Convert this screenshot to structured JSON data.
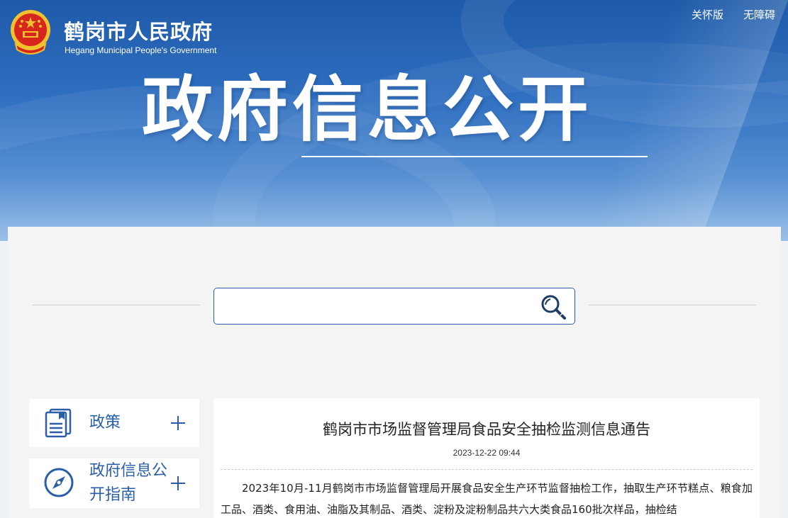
{
  "header": {
    "site_name": "鹤岗市人民政府",
    "site_name_en": "Hegang Municipal People's Government",
    "links": {
      "care": "关怀版",
      "accessibility": "无障碍"
    },
    "hero_title": "政府信息公开"
  },
  "search": {
    "value": "",
    "icon": "search-icon"
  },
  "sidebar": {
    "items": [
      {
        "label": "政策",
        "icon": "document-icon"
      },
      {
        "label": "政府信息公开指南",
        "icon": "compass-icon"
      }
    ]
  },
  "article": {
    "title": "鹤岗市市场监督管理局食品安全抽检监测信息通告",
    "date": "2023-12-22 09:44",
    "body": "2023年10月-11月鹤岗市市场监督管理局开展食品安全生产环节监督抽检工作，抽取生产环节糕点、粮食加工品、酒类、食用油、油脂及其制品、酒类、淀粉及淀粉制品共六大类食品160批次样品，抽检结"
  },
  "colors": {
    "brand": "#2a5fa8",
    "banner_top": "#1e5aa8",
    "banner_bottom": "#9bc0e8",
    "emblem_red": "#d7261e",
    "emblem_gold": "#f2c12e"
  }
}
